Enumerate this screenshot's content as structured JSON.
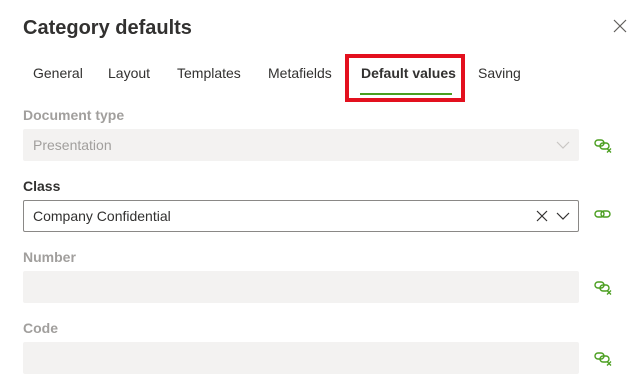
{
  "dialog": {
    "title": "Category defaults"
  },
  "tabs": [
    {
      "label": "General"
    },
    {
      "label": "Layout"
    },
    {
      "label": "Templates"
    },
    {
      "label": "Metafields"
    },
    {
      "label": "Default values",
      "active": true
    },
    {
      "label": "Saving"
    }
  ],
  "fields": {
    "document_type": {
      "label": "Document type",
      "value": "Presentation",
      "disabled": true
    },
    "class": {
      "label": "Class",
      "value": "Company Confidential",
      "disabled": false
    },
    "number": {
      "label": "Number",
      "value": "",
      "disabled": true
    },
    "code": {
      "label": "Code",
      "value": "",
      "disabled": true
    }
  },
  "colors": {
    "accent": "#4a9e1f",
    "highlight": "#e3101e",
    "disabled_bg": "#f3f2f1",
    "disabled_text": "#a19f9d"
  }
}
